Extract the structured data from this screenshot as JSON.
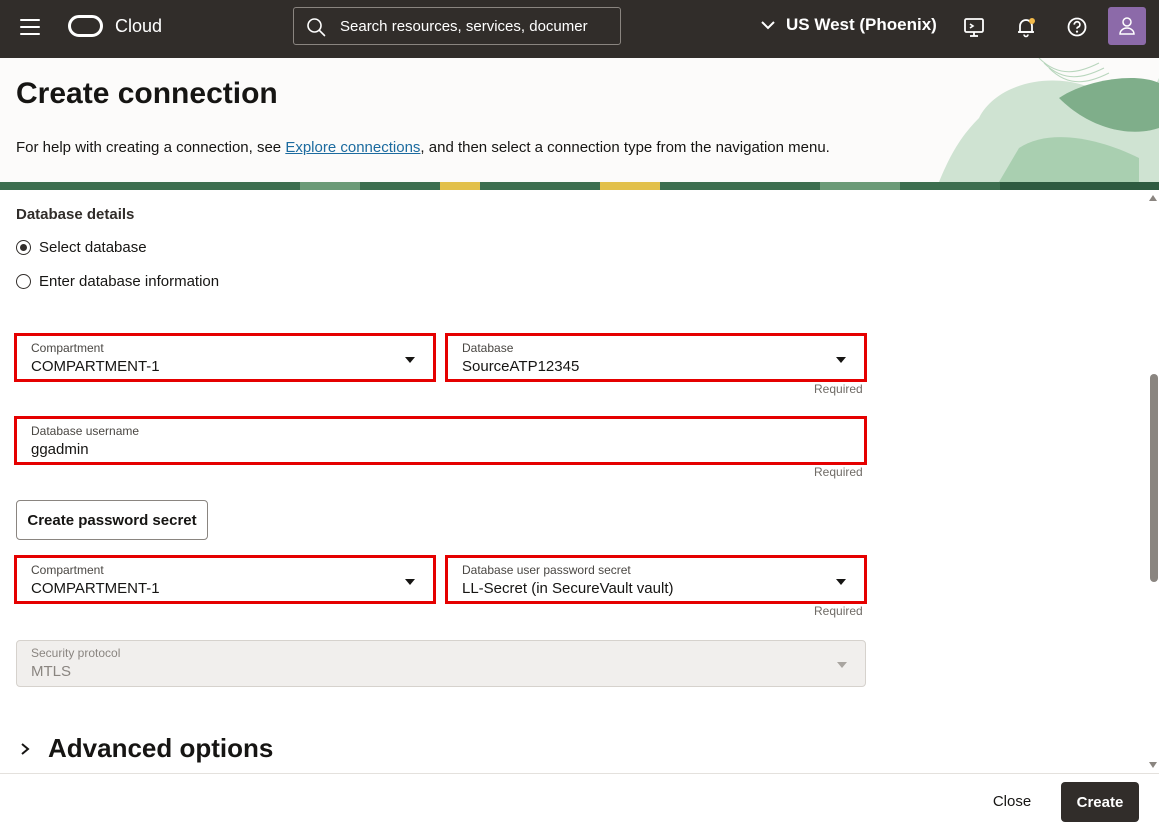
{
  "topbar": {
    "brand": "Cloud",
    "search_placeholder": "Search resources, services, documer",
    "region": "US West (Phoenix)",
    "icons": [
      "menu-icon",
      "search-icon",
      "chevron-down-icon",
      "cloud-shell-icon",
      "notifications-icon",
      "help-icon",
      "profile-icon"
    ]
  },
  "header": {
    "title": "Create connection",
    "help_prefix": "For help with creating a connection, see ",
    "help_link": "Explore connections",
    "help_suffix": ", and then select a connection type from the navigation menu."
  },
  "form": {
    "section_label": "Database details",
    "radio_select_db": "Select database",
    "radio_enter_db": "Enter database information",
    "compartment_label": "Compartment",
    "compartment_value": "COMPARTMENT-1",
    "database_label": "Database",
    "database_value": "SourceATP12345",
    "username_label": "Database username",
    "username_value": "ggadmin",
    "create_secret_button": "Create password secret",
    "compartment2_label": "Compartment",
    "compartment2_value": "COMPARTMENT-1",
    "secret_label": "Database user password secret",
    "secret_value": "LL-Secret (in SecureVault vault)",
    "protocol_label": "Security protocol",
    "protocol_value": "MTLS",
    "required": "Required",
    "advanced_options": "Advanced options"
  },
  "footer": {
    "close_label": "Close",
    "create_label": "Create"
  },
  "colors": {
    "topbar": "#312d2a",
    "highlight": "#e50000",
    "link": "#1c6b9f",
    "primary_button": "#312d2a"
  }
}
